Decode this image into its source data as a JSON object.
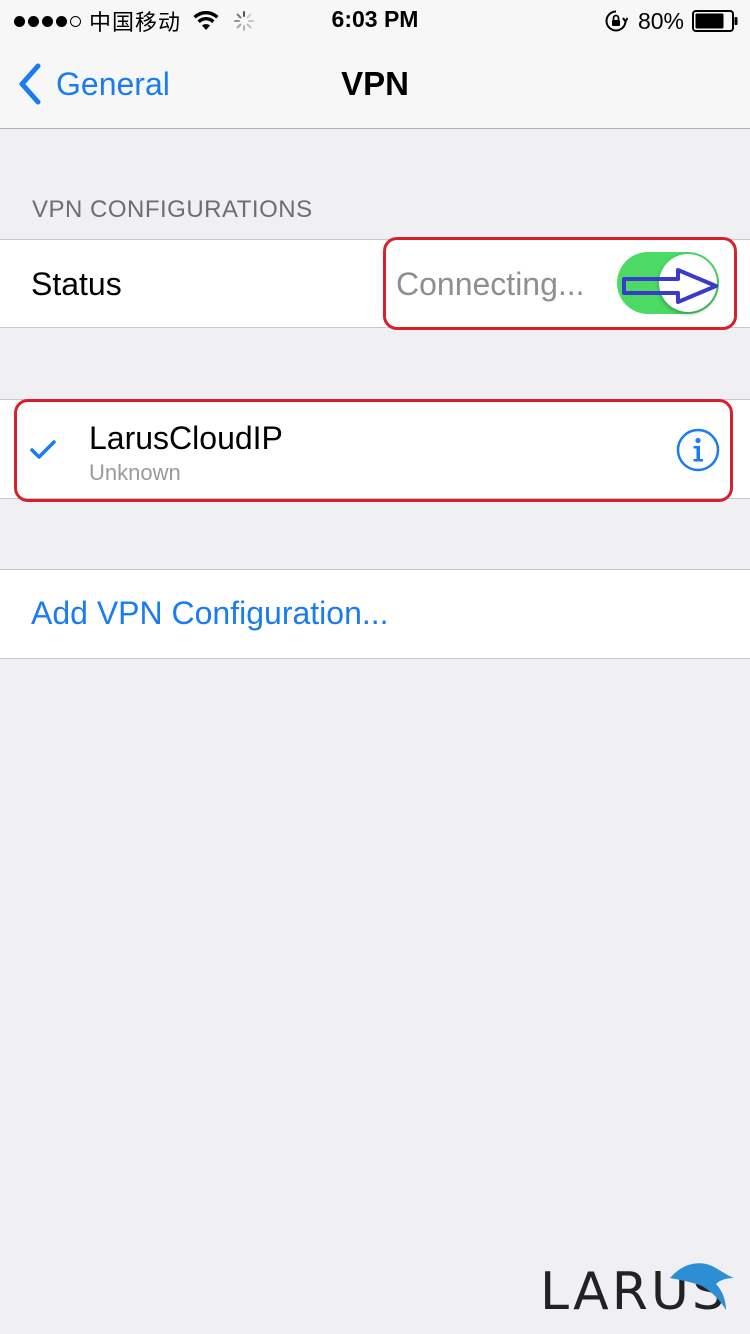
{
  "status_bar": {
    "carrier": "中国移动",
    "time": "6:03 PM",
    "battery": "80%",
    "battery_level": 0.8,
    "icons": [
      "signal-dots",
      "wifi-icon",
      "activity-spinner-icon",
      "rotation-lock-icon",
      "battery-icon"
    ]
  },
  "nav": {
    "back_label": "General",
    "title": "VPN"
  },
  "section": {
    "header": "VPN CONFIGURATIONS"
  },
  "status_row": {
    "label": "Status",
    "value": "Connecting...",
    "toggle_on": true
  },
  "vpn_config": {
    "name": "LarusCloudIP",
    "subtitle": "Unknown",
    "selected": true
  },
  "add_row": {
    "label": "Add VPN Configuration..."
  },
  "logo": {
    "text": "LARUS"
  },
  "colors": {
    "accent": "#1a7cf0",
    "switch_on": "#4cd964",
    "annotation": "#d8202b",
    "arrow": "#3a3acb",
    "background": "#efeff4"
  }
}
